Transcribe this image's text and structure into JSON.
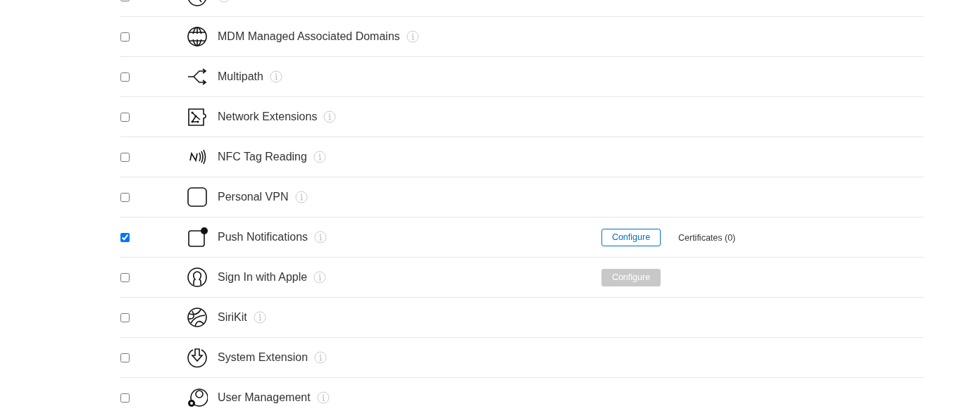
{
  "capabilities": [
    {
      "checked": false
    },
    {
      "label": "MDM Managed Associated Domains",
      "checked": false
    },
    {
      "label": "Multipath",
      "checked": false
    },
    {
      "label": "Network Extensions",
      "checked": false
    },
    {
      "label": "NFC Tag Reading",
      "checked": false
    },
    {
      "label": "Personal VPN",
      "checked": false
    },
    {
      "label": "Push Notifications",
      "checked": true,
      "button": {
        "label": "Configure",
        "disabled": false
      },
      "note": "Certificates (0)"
    },
    {
      "label": "Sign In with Apple",
      "checked": false,
      "button": {
        "label": "Configure",
        "disabled": true
      }
    },
    {
      "label": "SiriKit",
      "checked": false
    },
    {
      "label": "System Extension",
      "checked": false
    },
    {
      "label": "User Management",
      "checked": false
    }
  ]
}
